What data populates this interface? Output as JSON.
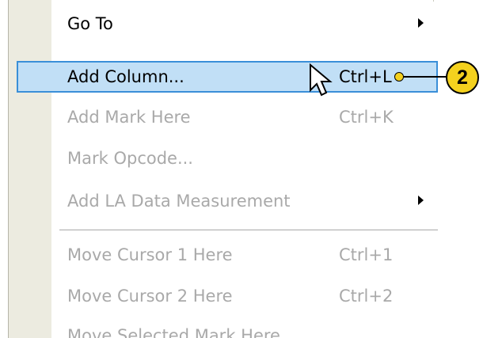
{
  "menu": {
    "items": [
      {
        "id": "go-to",
        "label": "Go To",
        "shortcut": "",
        "submenu": true,
        "enabled": true,
        "highlighted": false
      },
      {
        "id": "add-column",
        "label": "Add Column...",
        "shortcut": "Ctrl+L",
        "submenu": false,
        "enabled": true,
        "highlighted": true
      },
      {
        "id": "add-mark-here",
        "label": "Add Mark Here",
        "shortcut": "Ctrl+K",
        "submenu": false,
        "enabled": false,
        "highlighted": false
      },
      {
        "id": "mark-opcode",
        "label": "Mark Opcode...",
        "shortcut": "",
        "submenu": false,
        "enabled": false,
        "highlighted": false
      },
      {
        "id": "add-la-data-measurement",
        "label": "Add LA Data Measurement",
        "shortcut": "",
        "submenu": true,
        "enabled": false,
        "highlighted": false
      },
      {
        "id": "move-cursor-1-here",
        "label": "Move Cursor 1 Here",
        "shortcut": "Ctrl+1",
        "submenu": false,
        "enabled": false,
        "highlighted": false
      },
      {
        "id": "move-cursor-2-here",
        "label": "Move Cursor 2 Here",
        "shortcut": "Ctrl+2",
        "submenu": false,
        "enabled": false,
        "highlighted": false
      },
      {
        "id": "move-selected-mark-here",
        "label": "Move Selected Mark Here",
        "shortcut": "",
        "submenu": false,
        "enabled": false,
        "highlighted": false
      }
    ]
  },
  "callout": {
    "number": "2",
    "color": "#f4d11e"
  },
  "colors": {
    "highlight_fill": "#c1dff6",
    "highlight_border": "#3a8fd8",
    "disabled_text": "#a9a9a9",
    "gutter": "#ecebe0"
  },
  "icons": {
    "cursor": "mouse-pointer-icon",
    "submenu": "submenu-arrow-icon"
  }
}
